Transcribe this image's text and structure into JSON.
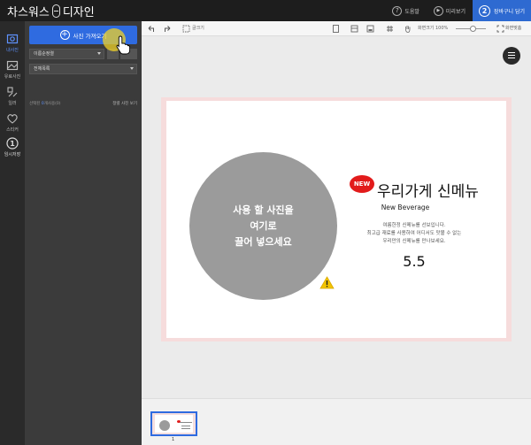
{
  "app": {
    "brand_left": "차스워스",
    "brand_right": "디자인"
  },
  "top_actions": [
    {
      "label": "도움말",
      "icon": "question-icon",
      "glyph": "?"
    },
    {
      "label": "미리보기",
      "icon": "play-icon",
      "glyph": "▶"
    }
  ],
  "cart": {
    "label": "장바구니 담기",
    "step": "2"
  },
  "rail": [
    {
      "label": "내사진",
      "icon": "photo-icon",
      "active": true
    },
    {
      "label": "유료사진",
      "icon": "paid-photo-icon",
      "active": false
    },
    {
      "label": "일러",
      "icon": "illustration-icon",
      "active": false
    },
    {
      "label": "스티커",
      "icon": "heart-icon",
      "active": false
    },
    {
      "label": "임시저장",
      "icon": "temp-save-icon",
      "active": false,
      "glyph": "1"
    }
  ],
  "panel": {
    "import_label": "사진 가져오기",
    "sort_value": "이름순정렬",
    "folder_value": "전체목록",
    "link_hint_prefix": "선택된 ",
    "link_hint_blue": "0",
    "link_hint_suffix": "개사용(0)",
    "link_right": "정렬 사진 보기"
  },
  "toolbar": {
    "resize_label": "글크기",
    "zoom_label": "화면크기 100%",
    "fit_label": "화면맞춤"
  },
  "design": {
    "dropzone_line1": "사용 할 사진을",
    "dropzone_line2": "여기로",
    "dropzone_line3": "끌어 넣으세요",
    "badge": "NEW",
    "headline": "우리가게 신메뉴",
    "subhead": "New Beverage",
    "desc1": "여름한정 신메뉴를 선보입니다.",
    "desc2": "최고급 재료를 사용하여 어디서도 맛볼 수 없는",
    "desc3": "우리만의 신메뉴를 만나보세요.",
    "price": "5.5"
  },
  "pages": {
    "current": "1"
  },
  "colors": {
    "accent": "#2f6be0",
    "badge": "#e21b1b",
    "dropzone": "#9b9b9b",
    "rail": "#2a2a2a",
    "panel": "#3b3b3b"
  }
}
